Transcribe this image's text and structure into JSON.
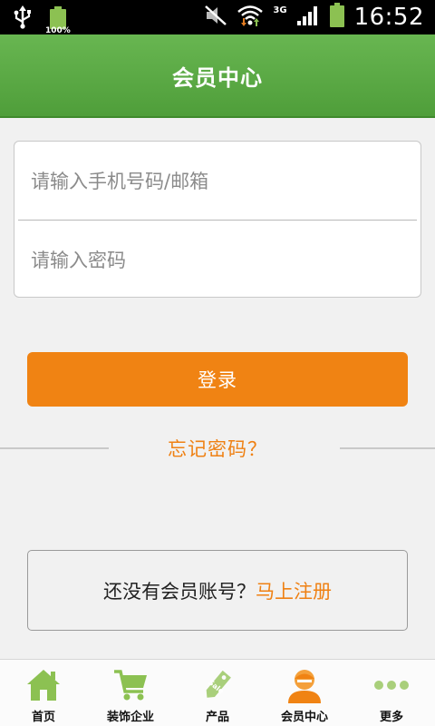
{
  "status_bar": {
    "battery_percent": "100%",
    "network_type": "3G",
    "time": "16:52"
  },
  "header": {
    "title": "会员中心"
  },
  "login_form": {
    "account_placeholder": "请输入手机号码/邮箱",
    "password_placeholder": "请输入密码",
    "submit_label": "登录",
    "forgot_password_label": "忘记密码？"
  },
  "register": {
    "prompt": "还没有会员账号？",
    "link_label": "马上注册"
  },
  "bottom_nav": {
    "items": [
      {
        "label": "首页",
        "icon": "home-icon"
      },
      {
        "label": "装饰企业",
        "icon": "cart-icon"
      },
      {
        "label": "产品",
        "icon": "sale-tag-icon"
      },
      {
        "label": "会员中心",
        "icon": "user-icon"
      },
      {
        "label": "更多",
        "icon": "more-icon"
      }
    ]
  },
  "colors": {
    "header_green": "#5aa845",
    "accent_orange": "#f08313",
    "icon_green": "#8cc152"
  }
}
